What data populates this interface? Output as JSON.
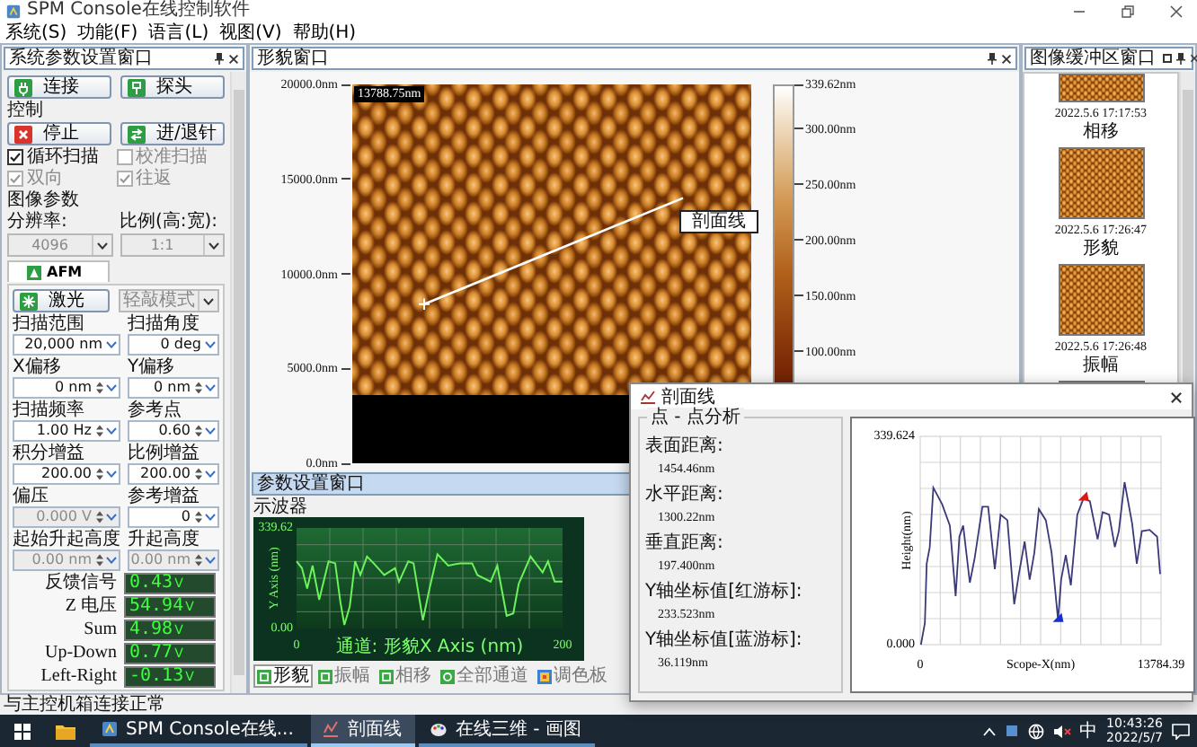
{
  "window": {
    "title": "SPM Console在线控制软件"
  },
  "menu": [
    "系统(S)",
    "功能(F)",
    "语言(L)",
    "视图(V)",
    "帮助(H)"
  ],
  "left_panel": {
    "title": "系统参数设置窗口",
    "top_buttons": [
      {
        "label": "连接",
        "kind": "connect"
      },
      {
        "label": "探头",
        "kind": "probe"
      }
    ],
    "control": {
      "label": "控制",
      "buttons": [
        {
          "label": "停止",
          "kind": "stop"
        },
        {
          "label": "进/退针",
          "kind": "approach"
        }
      ],
      "checkboxes": [
        {
          "label": "循环扫描",
          "checked": true,
          "disabled": false
        },
        {
          "label": "校准扫描",
          "checked": false,
          "disabled": true
        },
        {
          "label": "双向",
          "checked": true,
          "disabled": true
        },
        {
          "label": "往返",
          "checked": true,
          "disabled": true
        }
      ]
    },
    "image_params": {
      "label": "图像参数",
      "fields": [
        {
          "label": "分辨率:",
          "value": "4096",
          "disabled": true
        },
        {
          "label": "比例(高:宽):",
          "value": "1:1",
          "disabled": true
        }
      ]
    },
    "mode_tab": {
      "label": "AFM",
      "selected": true
    },
    "laser_button": {
      "label": "激光",
      "kind": "laser"
    },
    "mode_select": {
      "value": "轻敲模式",
      "disabled": true
    },
    "params": [
      {
        "label": "扫描范围",
        "value": "20,000 nm",
        "kind": "dropdown",
        "disabled": false
      },
      {
        "label": "扫描角度",
        "value": "0 deg",
        "kind": "dropdown",
        "disabled": false
      },
      {
        "label": "X偏移",
        "value": "0 nm",
        "kind": "spinner",
        "disabled": false
      },
      {
        "label": "Y偏移",
        "value": "0 nm",
        "kind": "spinner",
        "disabled": false
      },
      {
        "label": "扫描频率",
        "value": "1.00 Hz",
        "kind": "spinner",
        "disabled": false
      },
      {
        "label": "参考点",
        "value": "0.60",
        "kind": "spinner",
        "disabled": false
      },
      {
        "label": "积分增益",
        "value": "200.00",
        "kind": "spinner",
        "disabled": false
      },
      {
        "label": "比例增益",
        "value": "200.00",
        "kind": "spinner",
        "disabled": false
      },
      {
        "label": "偏压",
        "value": "0.000 V",
        "kind": "spinner",
        "disabled": true
      },
      {
        "label": "参考增益",
        "value": "0",
        "kind": "spinner",
        "disabled": false
      },
      {
        "label": "起始升起高度",
        "value": "0.00 nm",
        "kind": "spinner",
        "disabled": true
      },
      {
        "label": "升起高度",
        "value": "0.00 nm",
        "kind": "spinner",
        "disabled": true
      }
    ],
    "readouts": [
      {
        "label": "反馈信号",
        "value": "0.43",
        "unit": "V"
      },
      {
        "label": "Z 电压",
        "value": "54.94",
        "unit": "V"
      },
      {
        "label": "Sum",
        "value": "4.98",
        "unit": "V"
      },
      {
        "label": "Up-Down",
        "value": "0.77",
        "unit": "V"
      },
      {
        "label": "Left-Right",
        "value": "-0.13",
        "unit": "V"
      }
    ]
  },
  "image_view": {
    "title": "形貌窗口",
    "y_labels": [
      "20000.0nm",
      "15000.0nm",
      "10000.0nm",
      "5000.0nm",
      "0.0nm"
    ],
    "scale_label": "13788.75nm",
    "profile_label": "剖面线",
    "colorbar_labels": [
      "339.62nm",
      "300.00nm",
      "250.00nm",
      "200.00nm",
      "150.00nm",
      "100.00nm"
    ]
  },
  "params_window": {
    "title": "参数设置窗口",
    "group": "示波器",
    "chart_data": {
      "type": "line",
      "xlabel": "通道: 形貌X Axis (nm)",
      "ylabel": "Y Axis (nm)",
      "x": [
        0,
        4,
        8,
        12,
        17,
        24,
        29,
        33,
        36,
        40,
        44,
        48,
        53,
        58,
        66,
        74,
        77,
        84,
        88,
        95,
        100,
        106,
        114,
        123,
        132,
        136,
        146,
        151,
        158,
        163,
        167,
        176,
        185,
        189,
        194,
        200
      ],
      "series": [
        {
          "color": "#6cf25a",
          "values": [
            227,
            204,
            135,
            212,
            97,
            227,
            220,
            89,
            12,
            74,
            227,
            181,
            243,
            220,
            181,
            204,
            158,
            227,
            220,
            28,
            135,
            251,
            212,
            220,
            220,
            181,
            158,
            212,
            43,
            51,
            151,
            243,
            189,
            227,
            158,
            158
          ]
        }
      ],
      "xlim": [
        0,
        200
      ],
      "ylim": [
        0,
        339.62
      ],
      "xticks": [
        {
          "value": 0,
          "label": "0"
        },
        {
          "value": 200,
          "label": "200"
        }
      ],
      "yticks": [
        {
          "value": 0,
          "label": "0.00"
        },
        {
          "value": 339.62,
          "label": "339.62"
        }
      ]
    },
    "tabs": [
      {
        "label": "形貌",
        "kind": "channel",
        "selected": true
      },
      {
        "label": "振幅",
        "kind": "channel",
        "selected": false
      },
      {
        "label": "相移",
        "kind": "channel",
        "selected": false
      },
      {
        "label": "全部通道",
        "kind": "all",
        "selected": false
      },
      {
        "label": "调色板",
        "kind": "palette",
        "selected": false
      }
    ]
  },
  "buffer": {
    "title": "图像缓冲区窗口",
    "items": [
      {
        "time": "2022.5.6 17:17:53",
        "channel": "相移"
      },
      {
        "time": "2022.5.6 17:26:47",
        "channel": "形貌"
      },
      {
        "time": "2022.5.6 17:26:48",
        "channel": "振幅"
      }
    ]
  },
  "dialog": {
    "title": "剖面线",
    "group": "点 - 点分析",
    "measurements": [
      {
        "label": "表面距离:",
        "value": "1454.46nm"
      },
      {
        "label": "水平距离:",
        "value": "1300.22nm"
      },
      {
        "label": "垂直距离:",
        "value": "197.400nm"
      },
      {
        "label": "Y轴坐标值[红游标]:",
        "value": "233.523nm"
      },
      {
        "label": "Y轴坐标值[蓝游标]:",
        "value": "36.119nm"
      }
    ],
    "chart_data": {
      "type": "line",
      "xlabel": "Scope-X(nm)",
      "ylabel": "Height(nm)",
      "x": [
        44,
        264,
        374,
        550,
        747,
        1253,
        1693,
        2022,
        2242,
        2462,
        2835,
        3121,
        3561,
        3890,
        4264,
        4594,
        4990,
        5385,
        5649,
        5979,
        6264,
        6528,
        6792,
        7187,
        7517,
        7891,
        8067,
        8330,
        8616,
        8990,
        9342,
        9715,
        10155,
        10441,
        10815,
        11144,
        11364,
        11694,
        12133,
        12397,
        12683,
        13122,
        13562,
        13738
      ],
      "series": [
        {
          "color": "#3a3a78",
          "values": [
            0,
            35,
            132,
            159,
            256,
            229,
            194,
            79,
            176,
            194,
            101,
            141,
            225,
            225,
            123,
            212,
            203,
            66,
            115,
            168,
            106,
            150,
            221,
            203,
            150,
            40,
            106,
            146,
            97,
            212,
            238,
            234,
            172,
            216,
            212,
            159,
            185,
            265,
            198,
            132,
            185,
            187,
            176,
            115
          ]
        }
      ],
      "xlim": [
        0,
        13784.39
      ],
      "ylim": [
        0,
        339.624
      ],
      "xticks": [
        {
          "value": 0,
          "label": "0"
        },
        {
          "value": 13784.39,
          "label": "13784.39"
        }
      ],
      "yticks": [
        {
          "value": 0,
          "label": "0.000"
        },
        {
          "value": 339.624,
          "label": "339.624"
        }
      ]
    },
    "cursors": [
      {
        "color": "#e01515"
      },
      {
        "color": "#1a2fc8"
      }
    ]
  },
  "status_bar": "与主控机箱连接正常",
  "taskbar": {
    "apps": [
      {
        "label": "SPM Console在线...",
        "kind": "console",
        "selected": false
      },
      {
        "label": "剖面线",
        "kind": "chart",
        "selected": true
      },
      {
        "label": "在线三维 - 画图",
        "kind": "paint",
        "selected": false
      }
    ],
    "ime": "中",
    "time": "10:43:26",
    "date": "2022/5/7"
  }
}
